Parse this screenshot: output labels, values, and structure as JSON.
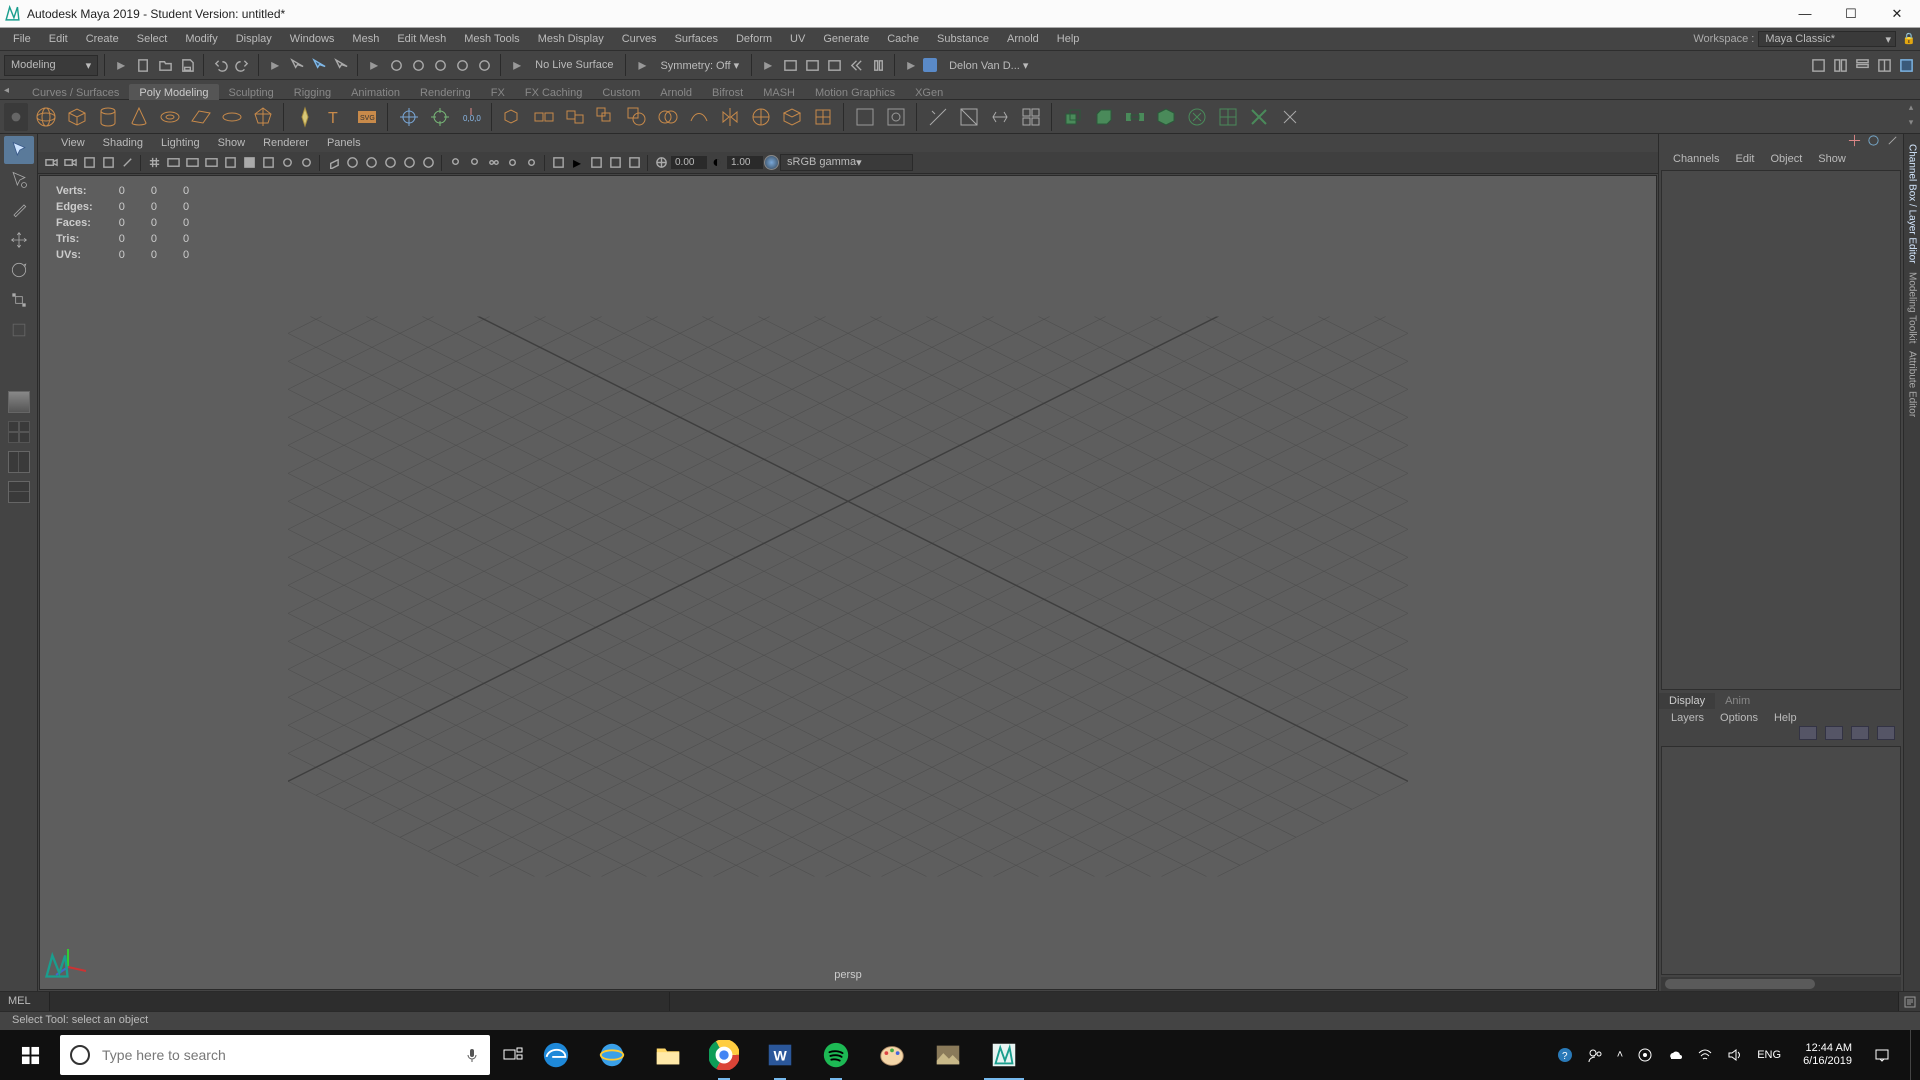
{
  "window": {
    "title": "Autodesk Maya 2019 - Student Version: untitled*"
  },
  "menubar": {
    "items": [
      "File",
      "Edit",
      "Create",
      "Select",
      "Modify",
      "Display",
      "Windows",
      "Mesh",
      "Edit Mesh",
      "Mesh Tools",
      "Mesh Display",
      "Curves",
      "Surfaces",
      "Deform",
      "UV",
      "Generate",
      "Cache",
      "Substance",
      "Arnold",
      "Help"
    ],
    "workspace_label": "Workspace :",
    "workspace_value": "Maya Classic*"
  },
  "statusline": {
    "module": "Modeling",
    "no_live": "No Live Surface",
    "symmetry": "Symmetry: Off",
    "account": "Delon Van D..."
  },
  "shelftabs": [
    "Curves / Surfaces",
    "Poly Modeling",
    "Sculpting",
    "Rigging",
    "Animation",
    "Rendering",
    "FX",
    "FX Caching",
    "Custom",
    "Arnold",
    "Bifrost",
    "MASH",
    "Motion Graphics",
    "XGen"
  ],
  "shelftabs_active": 1,
  "vpmenu": [
    "View",
    "Shading",
    "Lighting",
    "Show",
    "Renderer",
    "Panels"
  ],
  "vptoolbar": {
    "exp1": "0.00",
    "exp2": "1.00",
    "gamma": "sRGB gamma"
  },
  "hud": {
    "rows": [
      {
        "label": "Verts:",
        "a": "0",
        "b": "0",
        "c": "0"
      },
      {
        "label": "Edges:",
        "a": "0",
        "b": "0",
        "c": "0"
      },
      {
        "label": "Faces:",
        "a": "0",
        "b": "0",
        "c": "0"
      },
      {
        "label": "Tris:",
        "a": "0",
        "b": "0",
        "c": "0"
      },
      {
        "label": "UVs:",
        "a": "0",
        "b": "0",
        "c": "0"
      }
    ]
  },
  "viewport": {
    "camera": "persp"
  },
  "right": {
    "menu": [
      "Channels",
      "Edit",
      "Object",
      "Show"
    ],
    "lower_tabs": [
      "Display",
      "Anim"
    ],
    "lower_tabs_active": 0,
    "lower_menu": [
      "Layers",
      "Options",
      "Help"
    ],
    "side_tabs": [
      "Channel Box / Layer Editor",
      "Modeling Toolkit",
      "Attribute Editor"
    ]
  },
  "cmd": {
    "lang": "MEL"
  },
  "helpline": "Select Tool: select an object",
  "taskbar": {
    "search_placeholder": "Type here to search",
    "lang": "ENG",
    "time": "12:44 AM",
    "date": "6/16/2019"
  }
}
